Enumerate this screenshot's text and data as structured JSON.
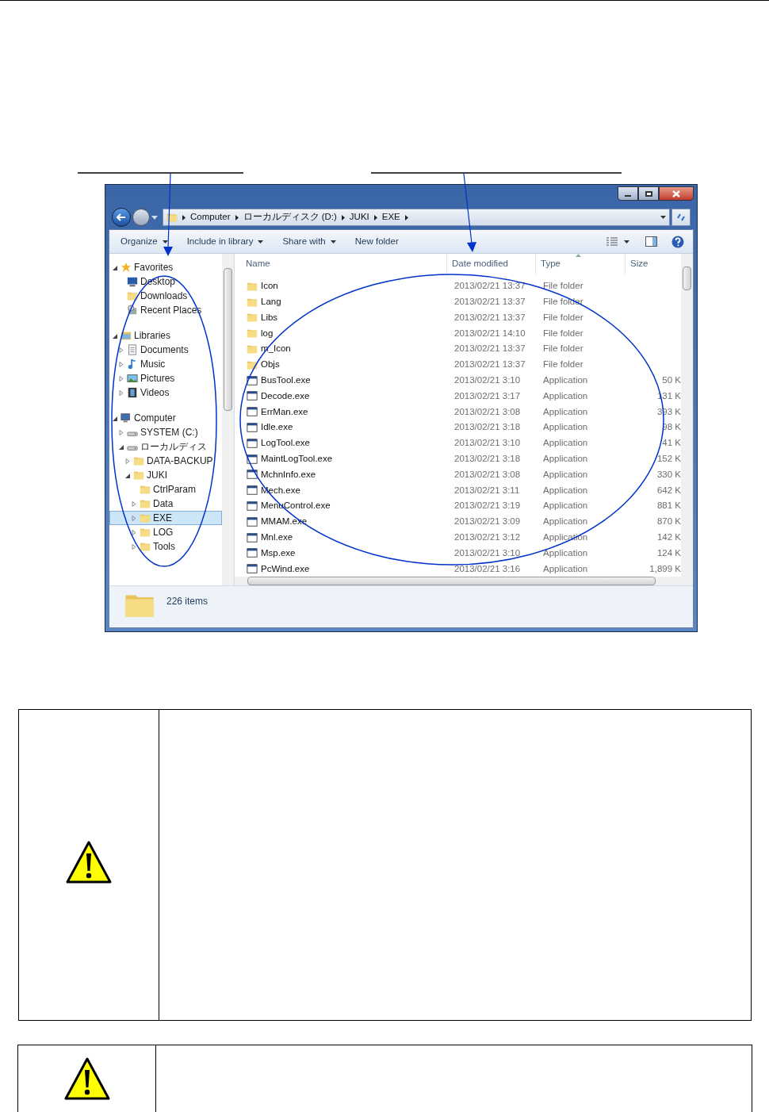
{
  "window": {
    "breadcrumb": [
      "Computer",
      "ローカルディスク (D:)",
      "JUKI",
      "EXE"
    ]
  },
  "toolbar": {
    "buttons": [
      {
        "label": "Organize",
        "dropdown": true
      },
      {
        "label": "Include in library",
        "dropdown": true
      },
      {
        "label": "Share with",
        "dropdown": true
      },
      {
        "label": "New folder",
        "dropdown": false
      }
    ]
  },
  "navigation_tree": [
    {
      "label": "Favorites",
      "kind": "favorites",
      "expanded": true,
      "selected": false,
      "children": [
        {
          "label": "Desktop",
          "kind": "desktop",
          "selected": false
        },
        {
          "label": "Downloads",
          "kind": "folder",
          "selected": false
        },
        {
          "label": "Recent Places",
          "kind": "recent",
          "selected": false
        }
      ]
    },
    {
      "label": "Libraries",
      "kind": "library",
      "expanded": true,
      "selected": false,
      "children": [
        {
          "label": "Documents",
          "kind": "document",
          "expanded": false,
          "selected": false
        },
        {
          "label": "Music",
          "kind": "music",
          "expanded": false,
          "selected": false
        },
        {
          "label": "Pictures",
          "kind": "picture",
          "expanded": false,
          "selected": false
        },
        {
          "label": "Videos",
          "kind": "video",
          "expanded": false,
          "selected": false
        }
      ]
    },
    {
      "label": "Computer",
      "kind": "computer",
      "expanded": true,
      "selected": false,
      "children": [
        {
          "label": "SYSTEM (C:)",
          "kind": "drive",
          "expanded": false,
          "selected": false
        },
        {
          "label": "ローカルディス",
          "kind": "drive",
          "expanded": true,
          "selected": false,
          "children": [
            {
              "label": "DATA-BACKUP",
              "kind": "folder",
              "expanded": false,
              "selected": false
            },
            {
              "label": "JUKI",
              "kind": "folder",
              "expanded": true,
              "selected": false,
              "children": [
                {
                  "label": "CtrlParam",
                  "kind": "folder",
                  "selected": false
                },
                {
                  "label": "Data",
                  "kind": "folder",
                  "expanded": false,
                  "selected": false
                },
                {
                  "label": "EXE",
                  "kind": "folder",
                  "expanded": false,
                  "selected": true
                },
                {
                  "label": "LOG",
                  "kind": "folder",
                  "expanded": false,
                  "selected": false
                },
                {
                  "label": "Tools",
                  "kind": "folder",
                  "expanded": false,
                  "selected": false
                }
              ]
            }
          ]
        }
      ]
    }
  ],
  "file_list": {
    "columns": [
      {
        "label": "Name",
        "sorted": false
      },
      {
        "label": "Date modified",
        "sorted": false
      },
      {
        "label": "Type",
        "sorted": true
      },
      {
        "label": "Size",
        "sorted": false
      }
    ],
    "rows": [
      {
        "name": "Icon",
        "date": "2013/02/21 13:37",
        "type": "File folder",
        "kind": "folder"
      },
      {
        "name": "Lang",
        "date": "2013/02/21 13:37",
        "type": "File folder",
        "kind": "folder"
      },
      {
        "name": "Libs",
        "date": "2013/02/21 13:37",
        "type": "File folder",
        "kind": "folder"
      },
      {
        "name": "log",
        "date": "2013/02/21 14:10",
        "type": "File folder",
        "kind": "folder"
      },
      {
        "name": "m_Icon",
        "date": "2013/02/21 13:37",
        "type": "File folder",
        "kind": "folder"
      },
      {
        "name": "Objs",
        "date": "2013/02/21 13:37",
        "type": "File folder",
        "kind": "folder"
      },
      {
        "name": "BusTool.exe",
        "date": "2013/02/21 3:10",
        "type": "Application",
        "size": "50 K",
        "kind": "application"
      },
      {
        "name": "Decode.exe",
        "date": "2013/02/21 3:17",
        "type": "Application",
        "size": "131 K",
        "kind": "application"
      },
      {
        "name": "ErrMan.exe",
        "date": "2013/02/21 3:08",
        "type": "Application",
        "size": "393 K",
        "kind": "application"
      },
      {
        "name": "Idle.exe",
        "date": "2013/02/21 3:18",
        "type": "Application",
        "size": "98 K",
        "kind": "application"
      },
      {
        "name": "LogTool.exe",
        "date": "2013/02/21 3:10",
        "type": "Application",
        "size": "41 K",
        "kind": "application"
      },
      {
        "name": "MaintLogTool.exe",
        "date": "2013/02/21 3:18",
        "type": "Application",
        "size": "152 K",
        "kind": "application"
      },
      {
        "name": "MchnInfo.exe",
        "date": "2013/02/21 3:08",
        "type": "Application",
        "size": "330 K",
        "kind": "application"
      },
      {
        "name": "Mech.exe",
        "date": "2013/02/21 3:11",
        "type": "Application",
        "size": "642 K",
        "kind": "application"
      },
      {
        "name": "MenuControl.exe",
        "date": "2013/02/21 3:19",
        "type": "Application",
        "size": "881 K",
        "kind": "application"
      },
      {
        "name": "MMAM.exe",
        "date": "2013/02/21 3:09",
        "type": "Application",
        "size": "870 K",
        "kind": "application"
      },
      {
        "name": "Mnl.exe",
        "date": "2013/02/21 3:12",
        "type": "Application",
        "size": "142 K",
        "kind": "application"
      },
      {
        "name": "Msp.exe",
        "date": "2013/02/21 3:10",
        "type": "Application",
        "size": "124 K",
        "kind": "application"
      },
      {
        "name": "PcWind.exe",
        "date": "2013/02/21 3:16",
        "type": "Application",
        "size": "1,899 K",
        "kind": "application"
      }
    ]
  },
  "status_bar": {
    "item_count": "226 items"
  }
}
